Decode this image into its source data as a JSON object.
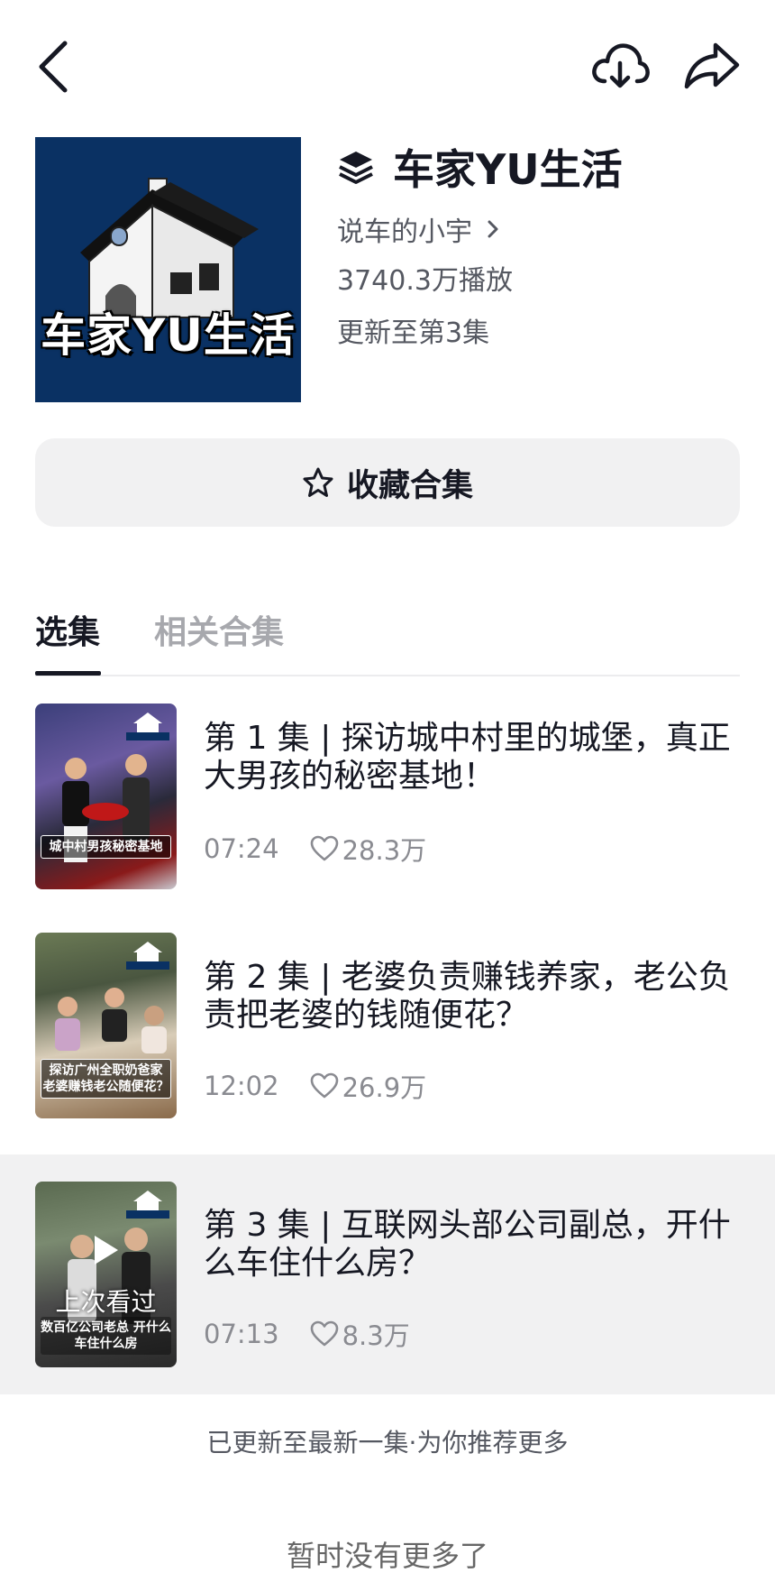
{
  "icons": {
    "back": "chevron-left-icon",
    "download": "cloud-download-icon",
    "share": "share-arrow-icon",
    "collection": "layers-icon",
    "author_chevron": "chevron-right-icon",
    "favorite": "star-icon",
    "like": "heart-icon",
    "play": "play-icon"
  },
  "collection": {
    "cover_text": "车家YU生活",
    "title": "车家YU生活",
    "author": "说车的小宇",
    "plays": "3740.3万播放",
    "update_status": "更新至第3集"
  },
  "favorite_button": {
    "label": "收藏合集"
  },
  "tabs": [
    {
      "label": "选集",
      "active": true
    },
    {
      "label": "相关合集",
      "active": false
    }
  ],
  "episodes": [
    {
      "title": "第 1 集 | 探访城中村里的城堡，真正大男孩的秘密基地！",
      "duration": "07:24",
      "likes": "28.3万",
      "thumb_caption": "城中村男孩秘密基地",
      "thumb_logo": "车家YU生活",
      "active": false
    },
    {
      "title": "第 2 集 | 老婆负责赚钱养家，老公负责把老婆的钱随便花？",
      "duration": "12:02",
      "likes": "26.9万",
      "thumb_caption": "探访广州全职奶爸家 老婆赚钱老公随便花？",
      "thumb_logo": "车家YU生活",
      "active": false
    },
    {
      "title": "第 3 集 | 互联网头部公司副总，开什么车住什么房？",
      "duration": "07:13",
      "likes": "8.3万",
      "thumb_caption": "数百亿公司老总 开什么车住什么房",
      "thumb_logo": "车家YU生活",
      "active": true,
      "overlay": "上次看过"
    }
  ],
  "footer_note": "已更新至最新一集·为你推荐更多",
  "bottom_text": "暂时没有更多了",
  "colors": {
    "text_primary": "#161823",
    "text_secondary": "#555861",
    "text_muted": "#a7a8ad",
    "button_bg": "#f1f1f2",
    "cover_bg": "#0a3163"
  }
}
